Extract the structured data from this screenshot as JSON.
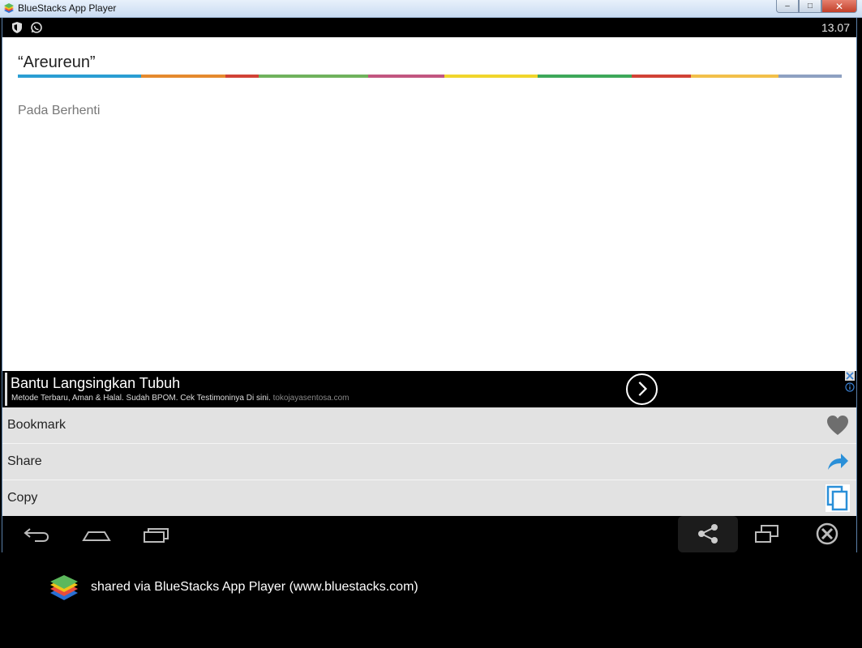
{
  "window": {
    "title": "BlueStacks App Player",
    "controls": {
      "minimize": "–",
      "maximize": "□",
      "close": "✕"
    }
  },
  "statusbar": {
    "icons": [
      "shield-icon",
      "whatsapp-icon"
    ],
    "time": "13.07"
  },
  "content": {
    "word": "“Areureun”",
    "definition": "Pada Berhenti",
    "accent_colors": [
      "#2a9ed3",
      "#e58a2e",
      "#d14236",
      "#6fb25d",
      "#c25680",
      "#f0d52b",
      "#3da85a",
      "#d14236",
      "#f2c04a",
      "#8ea1c2"
    ]
  },
  "ad": {
    "headline": "Bantu Langsingkan Tubuh",
    "description": "Metode Terbaru, Aman & Halal. Sudah BPOM. Cek Testimoninya Di sini.",
    "domain": "tokojayasentosa.com"
  },
  "actions": [
    {
      "label": "Bookmark",
      "icon": "heart-icon"
    },
    {
      "label": "Share",
      "icon": "share-arrow-icon"
    },
    {
      "label": "Copy",
      "icon": "copy-icon"
    }
  ],
  "navbar": {
    "icons": [
      "back-icon",
      "home-icon",
      "recent-apps-icon",
      "share-icon",
      "window-icon",
      "close-circle-icon"
    ]
  },
  "footer": {
    "text": "shared via BlueStacks App Player (www.bluestacks.com)"
  }
}
